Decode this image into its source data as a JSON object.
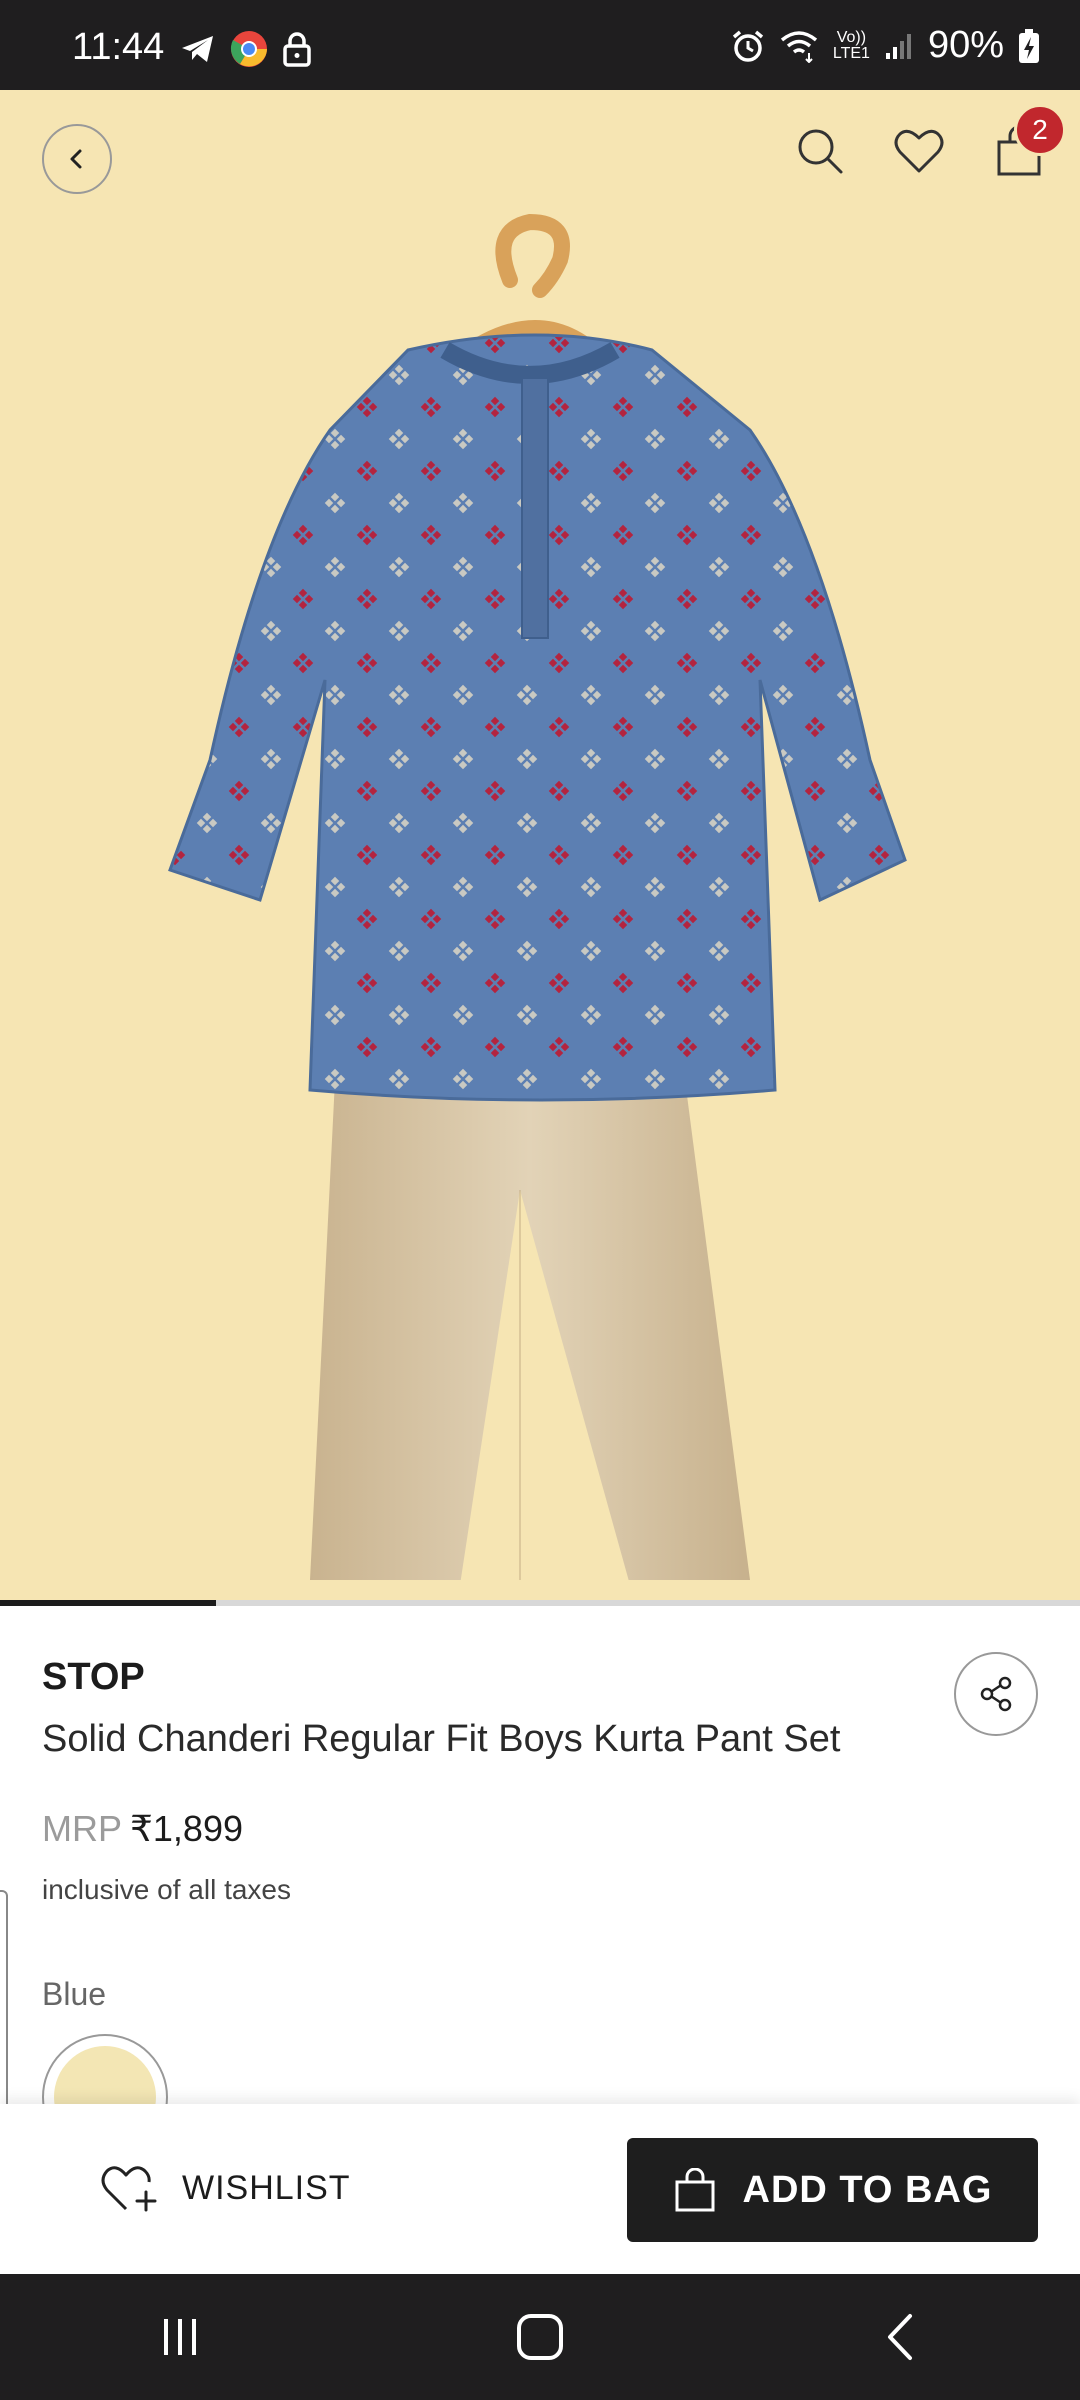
{
  "status_bar": {
    "time": "11:44",
    "battery": "90%",
    "network_label_top": "Vo))",
    "network_label_bottom": "LTE1",
    "icons": [
      "telegram-icon",
      "chrome-icon",
      "lock-icon",
      "alarm-icon",
      "wifi-icon",
      "signal-icon",
      "battery-charging-icon"
    ]
  },
  "header": {
    "cart_count": "2",
    "icons": [
      "back-icon",
      "search-icon",
      "heart-icon",
      "bag-icon"
    ]
  },
  "carousel": {
    "active_index": 1,
    "total": 5
  },
  "product": {
    "brand": "STOP",
    "title": "Solid Chanderi Regular Fit Boys Kurta Pant Set",
    "mrp_label": "MRP",
    "price": "₹1,899",
    "tax_note": "inclusive of all taxes",
    "color_name": "Blue",
    "colors": {
      "background": "#f6e5b3",
      "kurta": "#5c7fb2",
      "pants": "#d6c4a3",
      "accent_red": "#b3243f",
      "badge": "#c1272d"
    }
  },
  "actions": {
    "wishlist_label": "WISHLIST",
    "add_to_bag_label": "ADD TO BAG"
  },
  "nav": {
    "icons": [
      "recents-icon",
      "home-icon",
      "back-nav-icon"
    ]
  }
}
